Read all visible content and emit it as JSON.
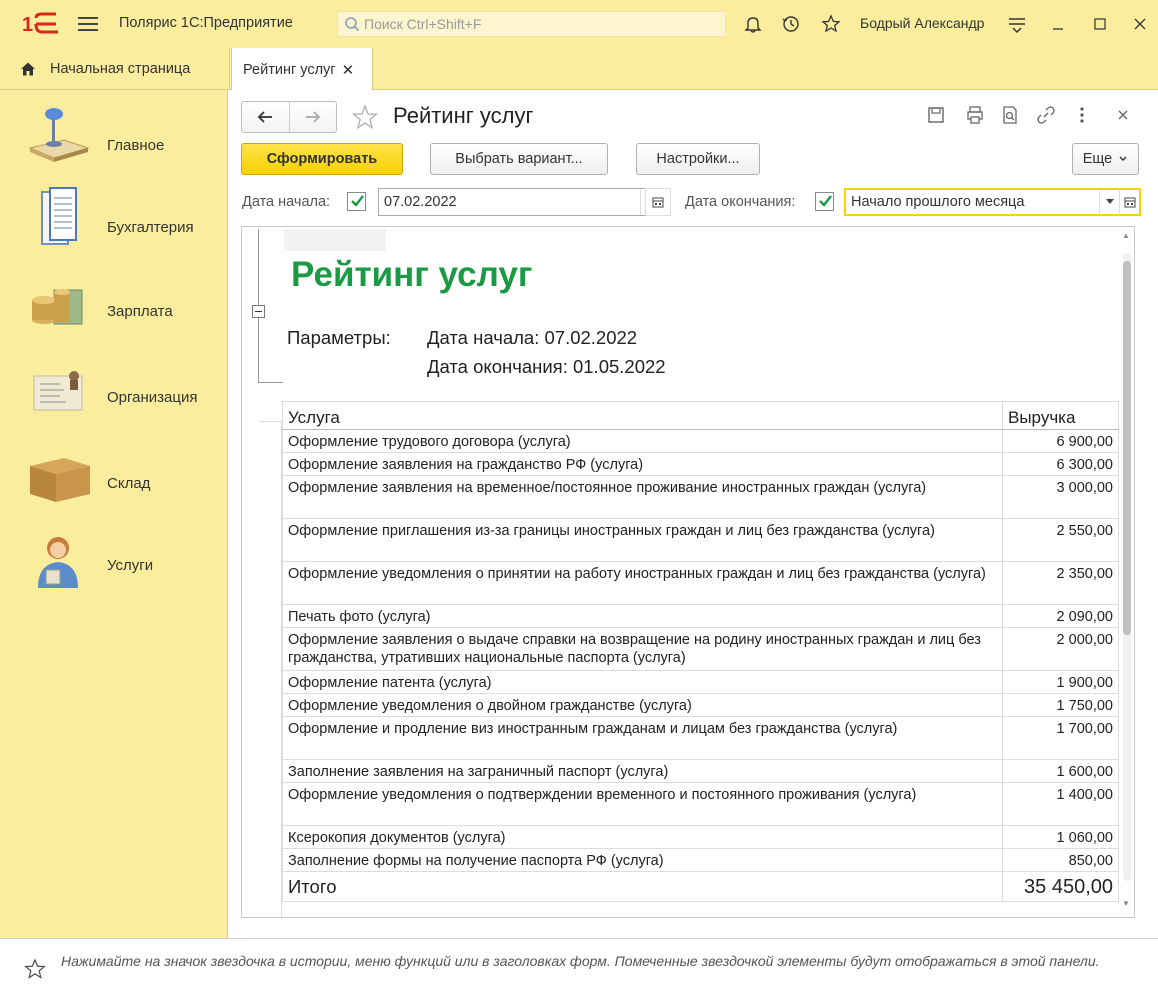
{
  "titlebar": {
    "app_title": "Полярис 1С:Предприятие",
    "search_placeholder": "Поиск Ctrl+Shift+F",
    "user_name": "Бодрый Александр",
    "icons": [
      "bell-icon",
      "history-icon",
      "star-icon",
      "settings-menu-icon",
      "minimize-icon",
      "maximize-icon",
      "close-icon"
    ]
  },
  "tabs": {
    "home_label": "Начальная страница",
    "active_label": "Рейтинг услуг"
  },
  "sidebar": {
    "items": [
      {
        "label": "Главное",
        "icon": "desk-lamp-icon"
      },
      {
        "label": "Бухгалтерия",
        "icon": "documents-icon"
      },
      {
        "label": "Зарплата",
        "icon": "coins-icon"
      },
      {
        "label": "Организация",
        "icon": "org-card-icon"
      },
      {
        "label": "Склад",
        "icon": "box-icon"
      },
      {
        "label": "Услуги",
        "icon": "operator-icon"
      }
    ]
  },
  "form": {
    "title": "Рейтинг услуг",
    "buttons": {
      "generate": "Сформировать",
      "choose_variant": "Выбрать вариант...",
      "settings": "Настройки...",
      "more": "Еще"
    },
    "date_start_label": "Дата начала:",
    "date_start_value": "07.02.2022",
    "date_end_label": "Дата окончания:",
    "date_end_value": "Начало прошлого месяца"
  },
  "report": {
    "title": "Рейтинг услуг",
    "params_label": "Параметры:",
    "param_start": "Дата начала: 07.02.2022",
    "param_end": "Дата окончания: 01.05.2022",
    "col_service": "Услуга",
    "col_revenue": "Выручка",
    "rows": [
      {
        "service": "Оформление трудового договора (услуга)",
        "revenue": "6 900,00"
      },
      {
        "service": "Оформление заявления на гражданство РФ (услуга)",
        "revenue": "6 300,00"
      },
      {
        "service": "Оформление заявления на временное/постоянное проживание иностранных граждан (услуга)",
        "revenue": "3 000,00"
      },
      {
        "service": "Оформление приглашения из-за границы иностранных граждан и лиц без гражданства (услуга)",
        "revenue": "2 550,00"
      },
      {
        "service": "Оформление уведомления о принятии на работу иностранных граждан и лиц без гражданства (услуга)",
        "revenue": "2 350,00"
      },
      {
        "service": "Печать фото (услуга)",
        "revenue": "2 090,00"
      },
      {
        "service": "Оформление заявления о выдаче справки на возвращение на родину иностранных граждан и лиц без гражданства, утративших национальные паспорта (услуга)",
        "revenue": "2 000,00"
      },
      {
        "service": "Оформление патента (услуга)",
        "revenue": "1 900,00"
      },
      {
        "service": "Оформление уведомления о двойном гражданстве (услуга)",
        "revenue": "1 750,00"
      },
      {
        "service": "Оформление и продление виз иностранным гражданам и лицам без гражданства (услуга)",
        "revenue": "1 700,00"
      },
      {
        "service": "Заполнение заявления на заграничный паспорт (услуга)",
        "revenue": "1 600,00"
      },
      {
        "service": "Оформление уведомления о подтверждении временного и постоянного проживания (услуга)",
        "revenue": "1 400,00"
      },
      {
        "service": "Ксерокопия документов (услуга)",
        "revenue": "1 060,00"
      },
      {
        "service": "Заполнение формы на получение паспорта РФ (услуга)",
        "revenue": "850,00"
      }
    ],
    "total_label": "Итого",
    "total_value": "35 450,00"
  },
  "footer": {
    "hint": "Нажимайте на значок звездочка в истории, меню функций или в заголовках форм. Помеченные звездочкой элементы будут отображаться в этой панели."
  }
}
